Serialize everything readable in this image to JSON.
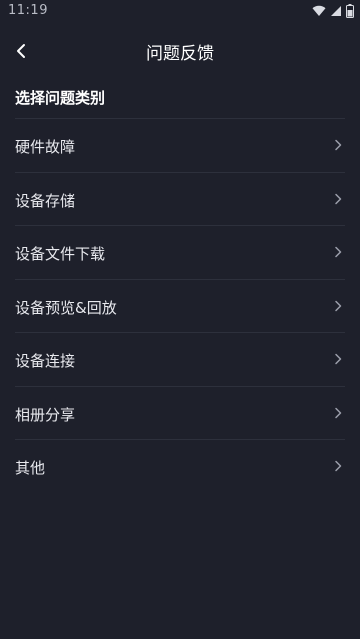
{
  "status_bar": {
    "time": "11:19"
  },
  "header": {
    "title": "问题反馈",
    "back_icon": "chevron-left-icon"
  },
  "section": {
    "title": "选择问题类别"
  },
  "categories": [
    {
      "label": "硬件故障"
    },
    {
      "label": "设备存储"
    },
    {
      "label": "设备文件下载"
    },
    {
      "label": "设备预览&回放"
    },
    {
      "label": "设备连接"
    },
    {
      "label": "相册分享"
    },
    {
      "label": "其他"
    }
  ],
  "colors": {
    "background": "#1e202b",
    "divider": "#2d303c",
    "text": "#ffffff",
    "chevron": "#9a9daa"
  }
}
